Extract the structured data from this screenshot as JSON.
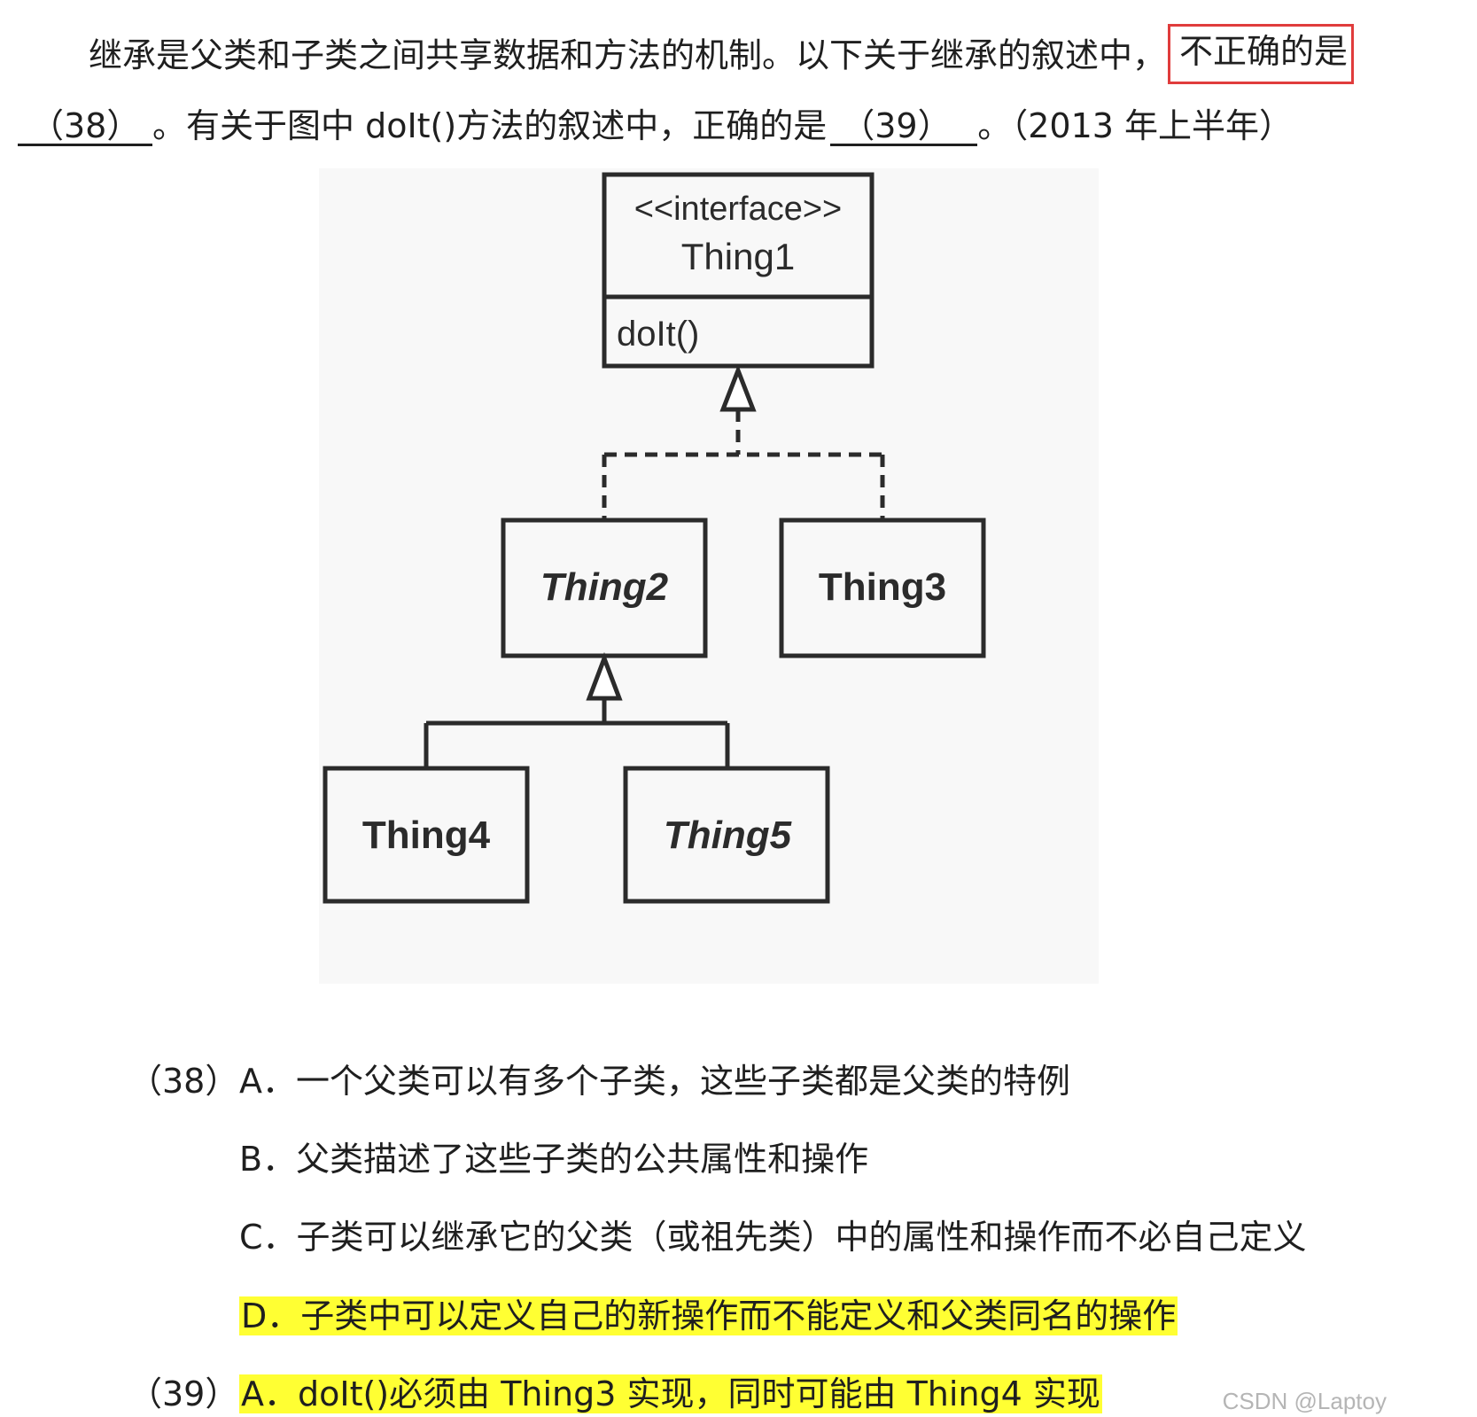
{
  "question": {
    "intro": "继承是父类和子类之间共享数据和方法的机制。以下关于继承的叙述中，",
    "highlight_boxed": "不正确的是",
    "blank38": "（38）",
    "mid": "。有关于图中 doIt()方法的叙述中，正确的是",
    "blank39": "（39）",
    "tail": "。（2013 年上半年）"
  },
  "diagram": {
    "interface_stereotype": "<<interface>>",
    "interface_name": "Thing1",
    "interface_method": "doIt()",
    "thing2": "Thing2",
    "thing3": "Thing3",
    "thing4": "Thing4",
    "thing5": "Thing5"
  },
  "options": {
    "q38_num": "（38）",
    "q38_a": "A．一个父类可以有多个子类，这些子类都是父类的特例",
    "q38_b": "B．父类描述了这些子类的公共属性和操作",
    "q38_c": "C．子类可以继承它的父类（或祖先类）中的属性和操作而不必自己定义",
    "q38_d": "D．子类中可以定义自己的新操作而不能定义和父类同名的操作",
    "q39_num": "（39）",
    "q39_a": "A．doIt()必须由 Thing3 实现，同时可能由 Thing4 实现"
  },
  "watermark": "CSDN @Laptoy",
  "colors": {
    "highlight": "#ffff33",
    "red_box": "#e03c3c"
  }
}
